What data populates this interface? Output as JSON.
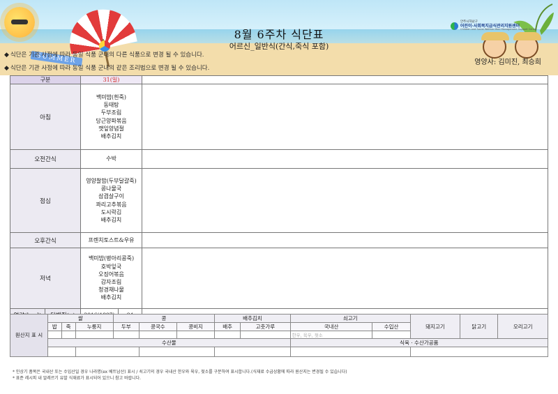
{
  "header": {
    "title": "8월 6주차 식단표",
    "subtitle": "어르신_일반식(간식,죽식 포함)",
    "dietitian": "영양사: 김미진, 최승희",
    "summer_tag": "SUMMER",
    "org": {
      "line1": "안주시하남구",
      "line2": "어린이·사회복지급식관리지원센터",
      "line3": "Children and Social Welfare Meal Management Support Center"
    },
    "notices": [
      "식단은 기관 사정에 따라 동일 식품 군내의 다른 식품으로 변경 될 수 있습니다.",
      "식단은 기관 사정에 따라 동일 식품 군내의 같은 조리법으로 변경 될 수 있습니다."
    ],
    "notice_mark": "◆"
  },
  "menu": {
    "header_label": "구분",
    "day_label": "31(일)",
    "meals": [
      {
        "label": "아침",
        "items": [
          "백미밥(흰죽)",
          "동태탕",
          "두부조림",
          "당근양파볶음",
          "깻잎양념절",
          "배추김치"
        ]
      },
      {
        "label": "오전간식",
        "items": [
          "수박"
        ]
      },
      {
        "label": "점심",
        "items": [
          "영양찰밥(두부달걀죽)",
          "콩나물국",
          "삼겹살구이",
          "꽈리고추볶음",
          "도시락김",
          "배추김치"
        ]
      },
      {
        "label": "오후간식",
        "items": [
          "프렌치토스트&우유"
        ]
      },
      {
        "label": "저녁",
        "items": [
          "백미밥(병아리콩죽)",
          "호박잎국",
          "오징어볶음",
          "감자조림",
          "청경채나물",
          "배추김치"
        ]
      }
    ],
    "nutrition": {
      "energy_label": "열량(kcal)",
      "protein_label": "단백질(g)",
      "energy_value": "2016(1897)",
      "protein_value": "84"
    }
  },
  "origin": {
    "title": "원산지 표 시",
    "groups": [
      "쌀",
      "콩",
      "배추김치",
      "쇠고기",
      "돼지고기",
      "닭고기",
      "오리고기"
    ],
    "rice_sub": [
      "밥",
      "죽",
      "누룽지"
    ],
    "bean_sub": [
      "두부",
      "콩국수",
      "콩비지"
    ],
    "kimchi_sub": [
      "배추",
      "고춧가루"
    ],
    "beef_sub": [
      "국내산",
      "수입산"
    ],
    "beef_note": "한우, 육우, 젖소",
    "seafood_label": "수산물",
    "seafood_processed_label": "식육 · 수산가공품"
  },
  "footnotes": [
    "* 인상기 품목은 국내산 또는 수입산일 경우 나라명(ex 베트남산) 표시 / 쇠고기의 경우 국내산 한우와 육우, 젖소를 구분하여 표시합니다.(식재료 수급상황에 따라 원산지는 변경될 수 있습니다)",
    "* 표준 레시피 내 알레르기 유발 식재료가 표시되어 있으니 참고 바랍니다."
  ]
}
